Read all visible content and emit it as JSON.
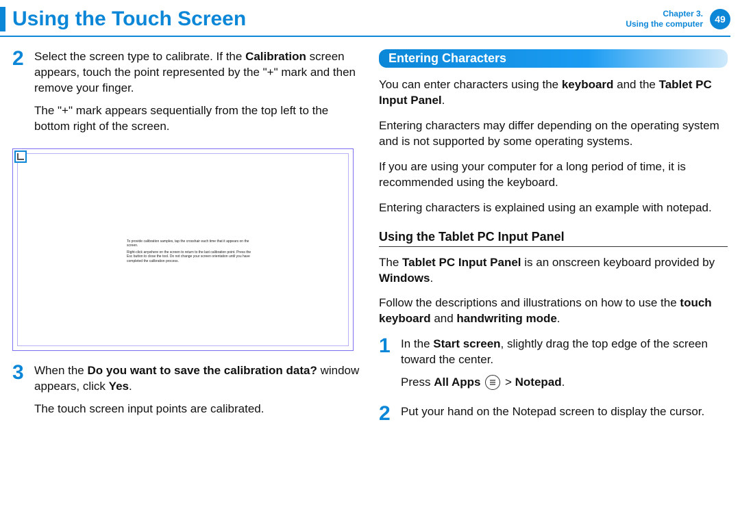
{
  "header": {
    "title": "Using the Touch Screen",
    "chapter_line1": "Chapter 3.",
    "chapter_line2": "Using the computer",
    "page_number": "49"
  },
  "left": {
    "step2": {
      "num": "2",
      "p1_pre": "Select the screen type to calibrate. If the ",
      "p1_bold": "Calibration",
      "p1_post": " screen appears, touch the point represented by the \"+\" mark and then remove your finger.",
      "p2": "The \"+\" mark appears sequentially from the top left to the bottom right of the screen."
    },
    "calib_text": {
      "l1": "To provide calibration samples, tap the crosshair each time that it appears on the screen.",
      "l2": "Right-click anywhere on the screen to return to the last calibration point. Press the Esc button to close the tool. Do not change your screen orientation until you have completed the calibration process."
    },
    "step3": {
      "num": "3",
      "p1_pre": "When the ",
      "p1_bold": "Do you want to save the calibration data?",
      "p1_post": " window appears, click ",
      "p1_bold2": "Yes",
      "p1_end": ".",
      "p2": "The touch screen input points are calibrated."
    }
  },
  "right": {
    "section_title": "Entering Characters",
    "p1_pre": "You can enter characters using the ",
    "p1_b1": "keyboard",
    "p1_mid": " and the ",
    "p1_b2": "Tablet PC Input Panel",
    "p1_end": ".",
    "p2": "Entering characters may differ depending on the operating system and is not supported by some operating systems.",
    "p3": "If you are using your computer for a long period of time, it is recommended using the keyboard.",
    "p4": "Entering characters is explained using an example with notepad.",
    "subhead": "Using the Tablet PC Input Panel",
    "p5_pre": "The ",
    "p5_b1": "Tablet PC Input Panel",
    "p5_mid": " is an onscreen keyboard provided by ",
    "p5_b2": "Windows",
    "p5_end": ".",
    "p6_pre": "Follow the descriptions and illustrations on how to use the ",
    "p6_b1": "touch keyboard",
    "p6_mid": " and ",
    "p6_b2": "handwriting mode",
    "p6_end": ".",
    "step1": {
      "num": "1",
      "p1_pre": "In the ",
      "p1_b1": "Start screen",
      "p1_post": ", slightly drag the top edge of the screen toward the center.",
      "p2_pre": "Press ",
      "p2_b1": "All Apps ",
      "p2_mid": " > ",
      "p2_b2": "Notepad",
      "p2_end": "."
    },
    "step2": {
      "num": "2",
      "p1": "Put your hand on the Notepad screen to display the cursor."
    }
  }
}
